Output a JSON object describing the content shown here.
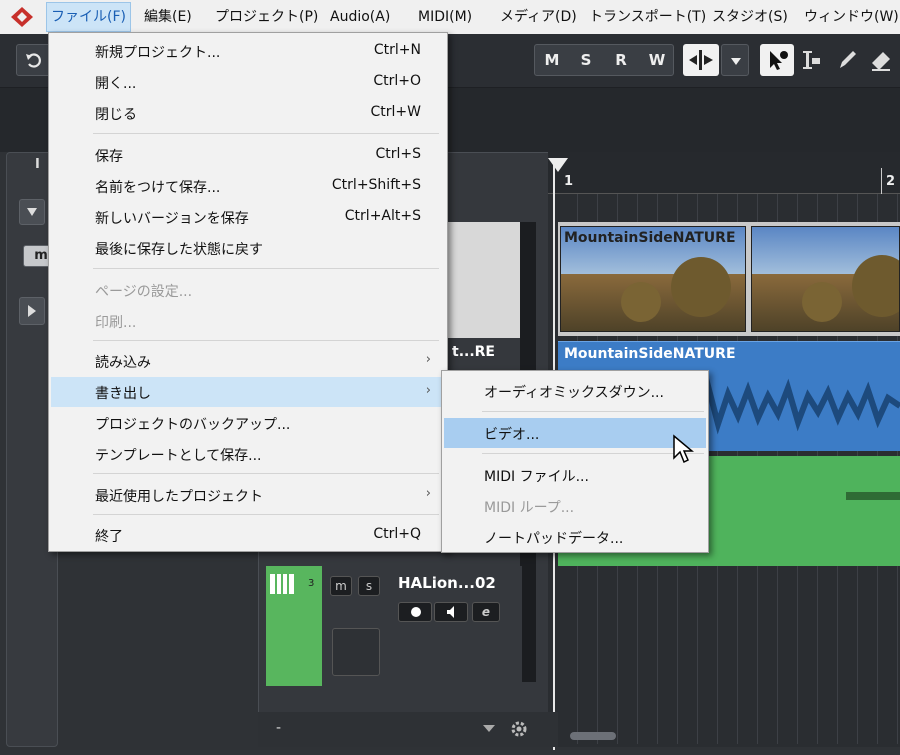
{
  "menubar": {
    "items": [
      "ファイル(F)",
      "編集(E)",
      "プロジェクト(P)",
      "Audio(A)",
      "MIDI(M)",
      "メディア(D)",
      "トランスポート(T)",
      "スタジオ(S)",
      "ウィンドウ(W)"
    ]
  },
  "toolbar": {
    "mode_buttons": [
      "M",
      "S",
      "R",
      "W"
    ],
    "tools": [
      "object-select-tool",
      "range-tool",
      "draw-tool",
      "erase-tool"
    ]
  },
  "inspector": {
    "tab_label": "I",
    "m_button": "m"
  },
  "ruler": {
    "marks": [
      "1",
      "2"
    ]
  },
  "tracks": {
    "video_clip_name": "MountainSideNATURE",
    "audio_clip_name": "MountainSideNATURE",
    "audio_track_name_partial": "t...RE",
    "track3": {
      "number": "3",
      "name": "HALion...02",
      "mute": "m",
      "solo": "s",
      "edit": "e"
    }
  },
  "file_menu": {
    "items": [
      {
        "label": "新規プロジェクト...",
        "shortcut": "Ctrl+N"
      },
      {
        "label": "開く...",
        "shortcut": "Ctrl+O"
      },
      {
        "label": "閉じる",
        "shortcut": "Ctrl+W"
      },
      {
        "label": "保存",
        "shortcut": "Ctrl+S"
      },
      {
        "label": "名前をつけて保存...",
        "shortcut": "Ctrl+Shift+S"
      },
      {
        "label": "新しいバージョンを保存",
        "shortcut": "Ctrl+Alt+S"
      },
      {
        "label": "最後に保存した状態に戻す",
        "shortcut": ""
      },
      {
        "label": "ページの設定...",
        "shortcut": ""
      },
      {
        "label": "印刷...",
        "shortcut": ""
      },
      {
        "label": "読み込み",
        "shortcut": ""
      },
      {
        "label": "書き出し",
        "shortcut": ""
      },
      {
        "label": "プロジェクトのバックアップ...",
        "shortcut": ""
      },
      {
        "label": "テンプレートとして保存...",
        "shortcut": ""
      },
      {
        "label": "最近使用したプロジェクト",
        "shortcut": ""
      },
      {
        "label": "終了",
        "shortcut": "Ctrl+Q"
      }
    ]
  },
  "export_submenu": {
    "items": [
      {
        "label": "オーディオミックスダウン..."
      },
      {
        "label": "ビデオ..."
      },
      {
        "label": "MIDI ファイル..."
      },
      {
        "label": "MIDI ループ..."
      },
      {
        "label": "ノートパッドデータ..."
      }
    ]
  },
  "bottom": {
    "left_label": "-"
  },
  "colors": {
    "menu_highlight": "#cce4f7",
    "submenu_highlight": "#a8cdf0",
    "audio_clip": "#3c7cc6",
    "midi_clip": "#4fb35c",
    "logo_red": "#c7302b"
  }
}
